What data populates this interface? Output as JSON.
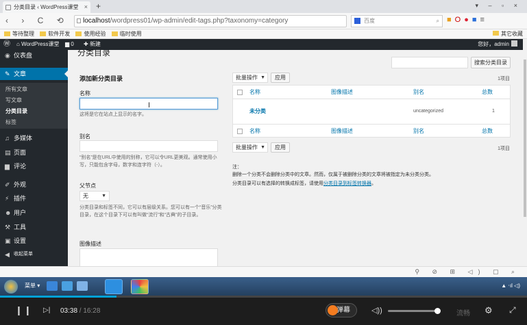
{
  "browser": {
    "tab_title": "分类目录 ‹ WordPress课堂",
    "url_host": "localhost",
    "url_path": "/wordpress01/wp-admin/edit-tags.php?taxonomy=category",
    "search_engine": "百度",
    "bookmarks": [
      "等待整理",
      "软件开发",
      "使用经验",
      "临时使用"
    ],
    "other_bookmarks": "其它收藏"
  },
  "adminbar": {
    "site_name": "WordPress课堂",
    "comment_count": "0",
    "new_label": "新建",
    "greeting": "您好，admin"
  },
  "sidebar": {
    "dashboard": "仪表盘",
    "posts": "文章",
    "sub_items": [
      "所有文章",
      "写文章",
      "分类目录",
      "标签"
    ],
    "media": "多媒体",
    "pages": "页面",
    "comments": "评论",
    "appearance": "外观",
    "plugins": "插件",
    "users": "用户",
    "tools": "工具",
    "settings": "设置",
    "collapse": "收起菜单"
  },
  "main": {
    "page_heading": "分类目录",
    "search_button": "搜索分类目录",
    "form": {
      "title": "添加新分类目录",
      "name_label": "名称",
      "name_help": "这将是它在站点上显示的名字。",
      "slug_label": "别名",
      "slug_help": "“别名”是在URL中使用的别称，它可以令URL更美观。通常使用小写，只能包含字母，数字和连字符（-）。",
      "parent_label": "父节点",
      "parent_value": "无",
      "parent_help": "分类目录和标签不同，它可以有层级关系。您可以有一个“音乐”分类目录，在这个目录下可以有叫做“流行”和“古典”的子目录。",
      "desc_label": "图像描述"
    },
    "bulk_label": "批量操作",
    "apply_label": "应用",
    "count_text": "1项目",
    "columns": [
      "名称",
      "图像描述",
      "别名",
      "总数"
    ],
    "rows": [
      {
        "name": "未分类",
        "desc": "",
        "slug": "uncategorized",
        "count": "1"
      }
    ],
    "note_label": "注：",
    "note_line1": "删除一个分类不会删除分类中的文章。然而，仅属于被删除分类的文章将被指定为未分类分类。",
    "note_line2_prefix": "分类目录可以有选择的转换成标签，请使用",
    "note_link": "分类目录到标签转换器",
    "note_line2_suffix": "。"
  },
  "taskbar": {
    "menu_label": "菜单"
  },
  "player": {
    "current_time": "03:38",
    "total_time": "16:28",
    "progress": 0.221,
    "danmu_label": "弹幕",
    "volume": 0.95,
    "quality_label": "流畅"
  }
}
